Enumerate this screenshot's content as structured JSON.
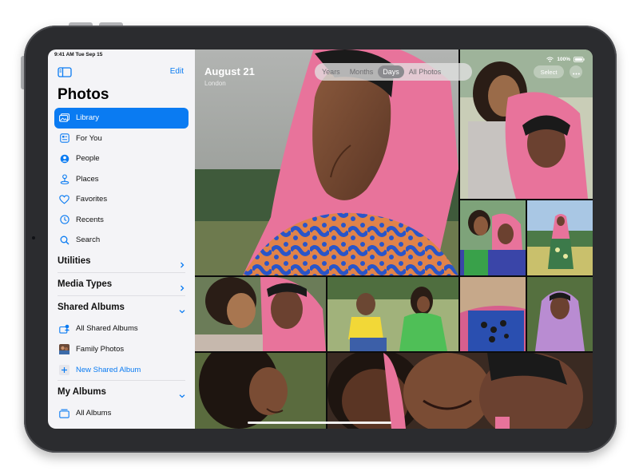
{
  "status_bar": {
    "time_date": "9:41 AM  Tue Sep 15",
    "battery_text": "100%",
    "icons": [
      "wifi-icon",
      "battery-icon"
    ]
  },
  "sidebar": {
    "title": "Photos",
    "edit_label": "Edit",
    "toggle_icon": "sidebar-toggle-icon",
    "nav_items": [
      {
        "label": "Library",
        "icon": "library-icon",
        "active": true
      },
      {
        "label": "For You",
        "icon": "for-you-icon",
        "active": false
      },
      {
        "label": "People",
        "icon": "people-icon",
        "active": false
      },
      {
        "label": "Places",
        "icon": "places-icon",
        "active": false
      },
      {
        "label": "Favorites",
        "icon": "heart-icon",
        "active": false
      },
      {
        "label": "Recents",
        "icon": "clock-icon",
        "active": false
      },
      {
        "label": "Search",
        "icon": "search-icon",
        "active": false
      }
    ],
    "sections": {
      "utilities": "Utilities",
      "media_types": "Media Types",
      "shared_albums": "Shared Albums",
      "my_albums": "My Albums"
    },
    "shared_albums_items": [
      {
        "label": "All Shared Albums",
        "icon": "shared-albums-icon"
      },
      {
        "label": "Family Photos",
        "icon": "album-thumbnail"
      },
      {
        "label": "New Shared Album",
        "icon": "plus-icon"
      }
    ],
    "my_albums_items": [
      {
        "label": "All Albums",
        "icon": "albums-icon"
      }
    ]
  },
  "photo_view": {
    "date_title": "August 21",
    "location": "London",
    "view_tabs": [
      {
        "label": "Years",
        "active": false
      },
      {
        "label": "Months",
        "active": false
      },
      {
        "label": "Days",
        "active": true
      },
      {
        "label": "All Photos",
        "active": false
      }
    ],
    "select_label": "Select",
    "more_icon": "ellipsis-icon"
  },
  "colors": {
    "accent": "#0a7bf2",
    "sidebar_bg": "#f4f4f7",
    "device_frame": "#2b2c2f",
    "hijab_pink": "#e8739b"
  }
}
